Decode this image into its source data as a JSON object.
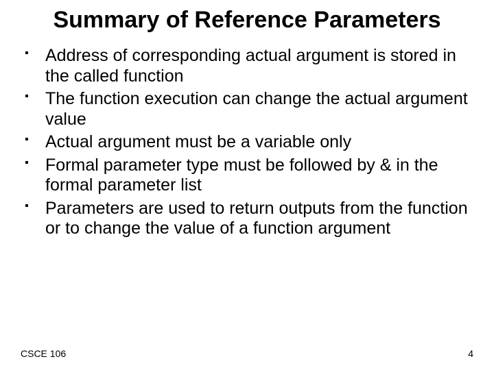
{
  "title": "Summary of Reference Parameters",
  "bullets": [
    "Address of corresponding actual argument is stored in the called function",
    "The function execution can change the actual argument value",
    "Actual argument must be a variable only",
    "Formal parameter type must be followed by & in the formal parameter list",
    "Parameters are used to return outputs from the function or to change the value of a function argument"
  ],
  "footer": {
    "left": "CSCE 106",
    "right": "4"
  }
}
